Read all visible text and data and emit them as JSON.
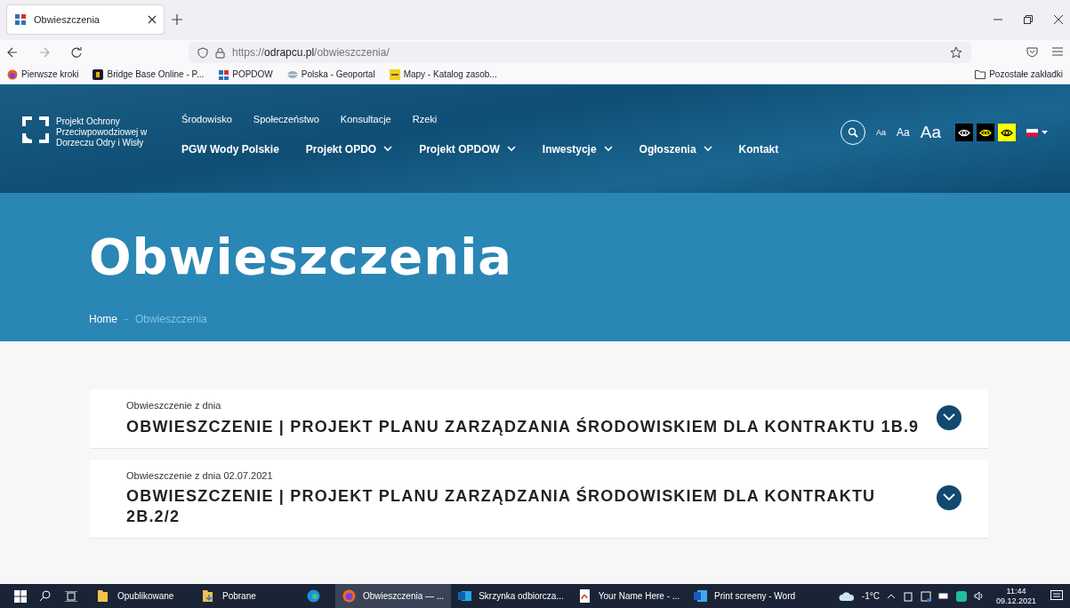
{
  "browser": {
    "tab": {
      "title": "Obwieszczenia",
      "selected": true
    },
    "url": {
      "scheme": "https://",
      "domain": "odrapcu.pl",
      "path": "/obwieszczenia/"
    },
    "bookmarks": [
      {
        "label": "Pierwsze kroki",
        "kind": "firefox"
      },
      {
        "label": "Bridge Base Online - P...",
        "kind": "bbo"
      },
      {
        "label": "POPDOW",
        "kind": "logo"
      },
      {
        "label": "Polska - Geoportal",
        "kind": "globe"
      },
      {
        "label": "Mapy - Katalog zasob...",
        "kind": "map"
      }
    ],
    "other_bookmarks": "Pozostałe zakładki"
  },
  "site": {
    "logo_text": "Projekt Ochrony Przeciwpowodziowej w Dorzeczu Odry i Wisły",
    "top_links": [
      "Środowisko",
      "Społeczeństwo",
      "Konsultacje",
      "Rzeki"
    ],
    "main_nav": [
      {
        "label": "PGW Wody Polskie",
        "has_dropdown": false
      },
      {
        "label": "Projekt OPDO",
        "has_dropdown": true
      },
      {
        "label": "Projekt OPDOW",
        "has_dropdown": true
      },
      {
        "label": "Inwestycje",
        "has_dropdown": true
      },
      {
        "label": "Ogłoszenia",
        "has_dropdown": true
      },
      {
        "label": "Kontakt",
        "has_dropdown": false
      }
    ],
    "font_sizes": [
      "Aa",
      "Aa",
      "Aa"
    ]
  },
  "hero": {
    "title": "Obwieszczenia",
    "separator": "-",
    "breadcrumbs": [
      {
        "label": "Home",
        "current": false
      },
      {
        "label": "Obwieszczenia",
        "current": true
      }
    ]
  },
  "notices": [
    {
      "date_label": "Obwieszczenie z dnia",
      "title": "OBWIESZCZENIE | PROJEKT PLANU ZARZĄDZANIA ŚRODOWISKIEM DLA KONTRAKTU 1B.9"
    },
    {
      "date_label": "Obwieszczenie z dnia 02.07.2021",
      "title": "OBWIESZCZENIE | PROJEKT PLANU ZARZĄDZANIA ŚRODOWISKIEM DLA KONTRAKTU 2B.2/2"
    }
  ],
  "taskbar": {
    "items": [
      {
        "label": "Opublikowane",
        "kind": "folder",
        "active": false
      },
      {
        "label": "Pobrane",
        "kind": "download",
        "active": false
      },
      {
        "kind": "edge",
        "active": false
      },
      {
        "label": "Obwieszczenia — ...",
        "kind": "firefox",
        "active": true
      },
      {
        "label": "Skrzynka odbiorcza...",
        "kind": "outlook",
        "active": false
      },
      {
        "label": "Your Name Here - ...",
        "kind": "pdf",
        "active": false
      },
      {
        "label": "Print screeny - Word",
        "kind": "word",
        "active": false
      }
    ],
    "weather": "-1°C",
    "time": "11:44",
    "date": "09.12.2021"
  }
}
